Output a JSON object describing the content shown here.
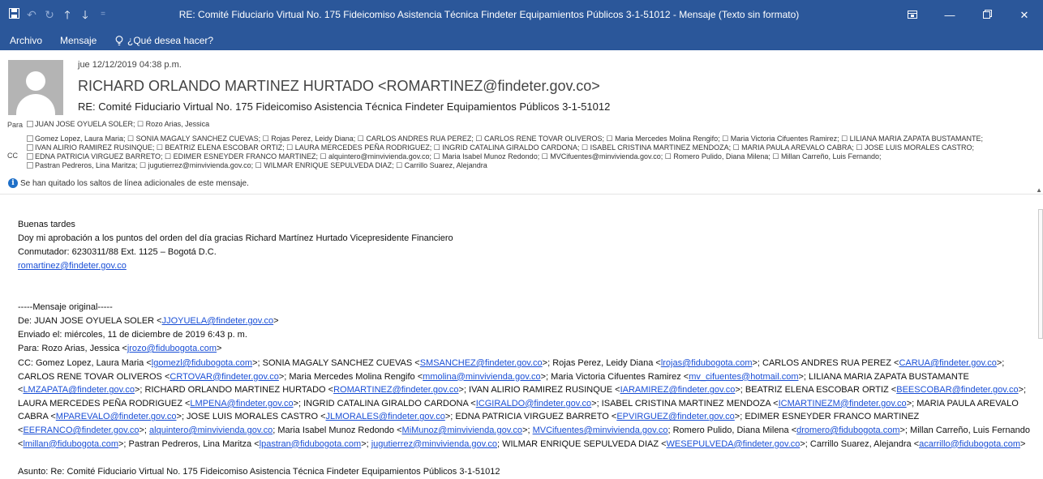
{
  "window": {
    "title": "RE: Comité Fiduciario Virtual No. 175 Fideicomiso Asistencia Técnica Findeter Equipamientos Públicos 3-1-51012 - Mensaje (Texto sin formato)",
    "qa_icons": [
      "save-icon",
      "undo-icon",
      "redo-icon",
      "up-arrow-icon",
      "down-arrow-icon",
      "customize-icon"
    ],
    "controls": [
      "ribbon-display-icon",
      "minimize-icon",
      "restore-icon",
      "close-icon"
    ]
  },
  "ribbon": {
    "tab_archivo": "Archivo",
    "tab_mensaje": "Mensaje",
    "tell_me": "¿Qué desea hacer?"
  },
  "header": {
    "date": "jue 12/12/2019 04:38 p.m.",
    "sender": "RICHARD ORLANDO MARTINEZ HURTADO <ROMARTINEZ@findeter.gov.co>",
    "subject": "RE: Comité Fiduciario Virtual No. 175 Fideicomiso Asistencia Técnica Findeter Equipamientos Públicos 3-1-51012",
    "para_label": "Para",
    "para_value": "JUAN JOSE OYUELA SOLER; ☐ Rozo Arias, Jessica",
    "cc_label": "CC",
    "cc_lines": [
      "Gomez Lopez, Laura Maria; ☐ SONIA MAGALY SANCHEZ CUEVAS; ☐ Rojas Perez, Leidy Diana; ☐ CARLOS ANDRES RUA PEREZ; ☐ CARLOS RENE TOVAR OLIVEROS; ☐ Maria Mercedes Molina Rengifo; ☐ Maria Victoria Cifuentes Ramirez; ☐ LILIANA MARIA ZAPATA BUSTAMANTE;",
      "IVAN ALIRIO RAMIREZ RUSINQUE; ☐ BEATRIZ ELENA ESCOBAR ORTIZ; ☐ LAURA MERCEDES PEÑA RODRIGUEZ; ☐ INGRID CATALINA GIRALDO CARDONA; ☐ ISABEL CRISTINA MARTINEZ MENDOZA; ☐ MARIA PAULA AREVALO CABRA; ☐ JOSE LUIS MORALES CASTRO;",
      "EDNA PATRICIA VIRGUEZ BARRETO; ☐ EDIMER ESNEYDER FRANCO MARTINEZ; ☐ alquintero@minvivienda.gov.co; ☐ Maria Isabel Munoz Redondo; ☐ MVCifuentes@minvivienda.gov.co; ☐ Romero Pulido, Diana Milena; ☐ Millan Carreño, Luis Fernando;",
      "Pastran Pedreros, Lina Maritza; ☐ jugutierrez@minvivienda.gov.co; ☐ WILMAR ENRIQUE SEPULVEDA DIAZ; ☐ Carrillo Suarez, Alejandra"
    ],
    "info": "Se han quitado los saltos de línea adicionales de este mensaje."
  },
  "body": {
    "greeting": "Buenas tardes",
    "line1": "Doy mi aprobación a los puntos del orden del día gracias Richard Martínez Hurtado Vicepresidente Financiero",
    "line2": "Conmutador:  6230311/88  Ext. 1125 – Bogotá D.C.",
    "email_link": "romartinez@findeter.gov.co",
    "orig_header": "-----Mensaje original-----",
    "de_prefix": "De: JUAN JOSE OYUELA SOLER <",
    "de_link": "JJOYUELA@findeter.gov.co",
    "de_suffix": ">",
    "enviado": "Enviado el: miércoles, 11 de diciembre de 2019 6:43 p. m.",
    "para_prefix": "Para: Rozo Arias, Jessica <",
    "para_link": "jrozo@fidubogota.com",
    "para_suffix": ">",
    "asunto": "Asunto: Re: Comité Fiduciario Virtual No. 175 Fideicomiso Asistencia Técnica Findeter Equipamientos Públicos 3-1-51012",
    "cc_segments": [
      {
        "t": "CC: Gomez Lopez, Laura Maria <"
      },
      {
        "t": "lgomezl@fidubogota.com",
        "link": true
      },
      {
        "t": ">; SONIA MAGALY SANCHEZ CUEVAS <"
      },
      {
        "t": "SMSANCHEZ@findeter.gov.co",
        "link": true
      },
      {
        "t": ">; Rojas Perez, Leidy Diana <"
      },
      {
        "t": "lrojas@fidubogota.com",
        "link": true
      },
      {
        "t": ">; CARLOS ANDRES RUA PEREZ <"
      },
      {
        "t": "CARUA@findeter.gov.co",
        "link": true
      },
      {
        "t": ">; CARLOS RENE TOVAR OLIVEROS <"
      },
      {
        "t": "CRTOVAR@findeter.gov.co",
        "link": true
      },
      {
        "t": ">; Maria Mercedes Molina Rengifo <"
      },
      {
        "t": "mmolina@minvivienda.gov.co",
        "link": true
      },
      {
        "t": ">; Maria Victoria Cifuentes Ramirez <"
      },
      {
        "t": "mv_cifuentes@hotmail.com",
        "link": true
      },
      {
        "t": ">; LILIANA MARIA ZAPATA BUSTAMANTE <"
      },
      {
        "t": "LMZAPATA@findeter.gov.co",
        "link": true
      },
      {
        "t": ">; RICHARD ORLANDO MARTINEZ HURTADO <"
      },
      {
        "t": "ROMARTINEZ@findeter.gov.co",
        "link": true
      },
      {
        "t": ">; IVAN ALIRIO RAMIREZ RUSINQUE <"
      },
      {
        "t": "IARAMIREZ@findeter.gov.co",
        "link": true
      },
      {
        "t": ">; BEATRIZ ELENA ESCOBAR ORTIZ <"
      },
      {
        "t": "BEESCOBAR@findeter.gov.co",
        "link": true
      },
      {
        "t": ">; LAURA MERCEDES PEÑA RODRIGUEZ <"
      },
      {
        "t": "LMPENA@findeter.gov.co",
        "link": true
      },
      {
        "t": ">; INGRID CATALINA GIRALDO CARDONA <"
      },
      {
        "t": "ICGIRALDO@findeter.gov.co",
        "link": true
      },
      {
        "t": ">; ISABEL CRISTINA MARTINEZ MENDOZA <"
      },
      {
        "t": "ICMARTINEZM@findeter.gov.co",
        "link": true
      },
      {
        "t": ">; MARIA PAULA AREVALO CABRA <"
      },
      {
        "t": "MPAREVALO@findeter.gov.co",
        "link": true
      },
      {
        "t": ">; JOSE LUIS MORALES CASTRO <"
      },
      {
        "t": "JLMORALES@findeter.gov.co",
        "link": true
      },
      {
        "t": ">; EDNA PATRICIA VIRGUEZ BARRETO <"
      },
      {
        "t": "EPVIRGUEZ@findeter.gov.co",
        "link": true
      },
      {
        "t": ">; EDIMER ESNEYDER FRANCO MARTINEZ <"
      },
      {
        "t": "EEFRANCO@findeter.gov.co",
        "link": true
      },
      {
        "t": ">; "
      },
      {
        "t": "alquintero@minvivienda.gov.co",
        "link": true
      },
      {
        "t": "; Maria Isabel Munoz Redondo <"
      },
      {
        "t": "MiMunoz@minvivienda.gov.co",
        "link": true
      },
      {
        "t": ">; "
      },
      {
        "t": "MVCifuentes@minvivienda.gov.co",
        "link": true
      },
      {
        "t": "; Romero Pulido, Diana Milena <"
      },
      {
        "t": "dromero@fidubogota.com",
        "link": true
      },
      {
        "t": ">; Millan Carreño, Luis Fernando <"
      },
      {
        "t": "lmillan@fidubogota.com",
        "link": true
      },
      {
        "t": ">; Pastran Pedreros, Lina Maritza <"
      },
      {
        "t": "lpastran@fidubogota.com",
        "link": true
      },
      {
        "t": ">; "
      },
      {
        "t": "jugutierrez@minvivienda.gov.co",
        "link": true
      },
      {
        "t": "; WILMAR ENRIQUE SEPULVEDA DIAZ <"
      },
      {
        "t": "WESEPULVEDA@findeter.gov.co",
        "link": true
      },
      {
        "t": ">; Carrillo Suarez, Alejandra <"
      },
      {
        "t": "acarrillo@fidubogota.com",
        "link": true
      },
      {
        "t": ">"
      }
    ]
  },
  "colors": {
    "titlebar": "#2b579a",
    "link": "#1a4fd6",
    "info_icon": "#1e6fc8"
  }
}
